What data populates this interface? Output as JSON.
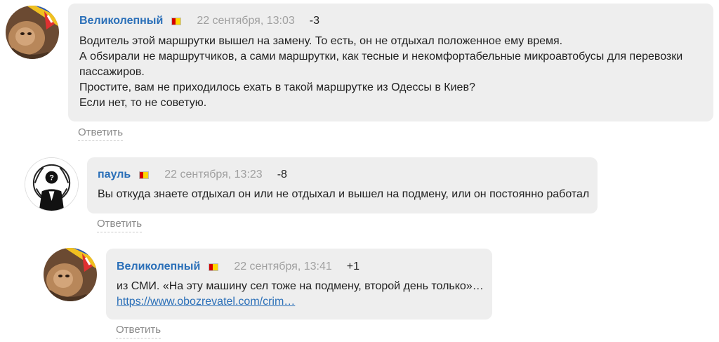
{
  "comments": [
    {
      "author": "Великолепный",
      "date": "22 сентября, 13:03",
      "rating": "-3",
      "avatar_icon": "lion-avatar-icon",
      "lines": [
        "Водитель этой маршрутки вышел на замену. То есть, он не отдыхал положенное ему время.",
        "А обsирали не маршрутчиков, а сами маршрутки, как тесные и некомфортабельные микроавтобусы для перевозки",
        "пассажиров.",
        "Простите, вам не приходилось ехать в такой маршрутке из Одессы в Киев?",
        "Если нет, то не советую."
      ],
      "reply_label": "Ответить"
    },
    {
      "author": "пауль",
      "date": "22 сентября, 13:23",
      "rating": "-8",
      "avatar_icon": "anonymous-mask-avatar-icon",
      "lines": [
        "Вы откуда знаете отдыхал он или не отдыхал и вышел на подмену, или он постоянно работал"
      ],
      "reply_label": "Ответить"
    },
    {
      "author": "Великолепный",
      "date": "22 сентября, 13:41",
      "rating": "+1",
      "avatar_icon": "lion-avatar-icon",
      "lines": [
        "из СМИ. «На эту машину сел тоже на подмену, второй день только»…"
      ],
      "link": "https://www.obozrevatel.com/crim…",
      "reply_label": "Ответить"
    }
  ],
  "colors": {
    "bubble": "#eeeeee",
    "author": "#2a6fb8",
    "date": "#a0a0a0",
    "reply": "#8a8a8a"
  }
}
